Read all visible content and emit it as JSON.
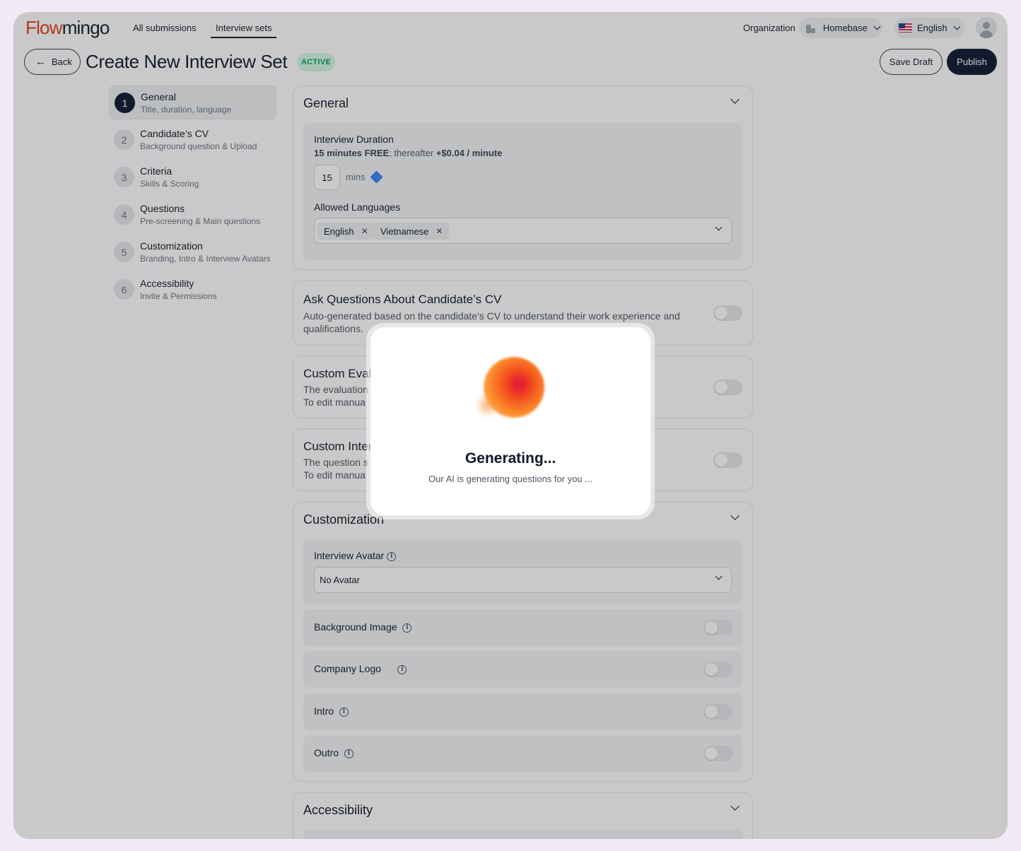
{
  "header": {
    "logo_part1": "Flow",
    "logo_part2": "mingo",
    "nav": [
      "All submissions",
      "Interview sets"
    ],
    "org_label": "Organization",
    "org_name": "Homebase",
    "language": "English"
  },
  "title_bar": {
    "back": "Back",
    "title": "Create New Interview Set",
    "status": "ACTIVE",
    "save_draft": "Save Draft",
    "publish": "Publish"
  },
  "steps": [
    {
      "num": "1",
      "title": "General",
      "sub": "Title, duration, language"
    },
    {
      "num": "2",
      "title": "Candidate’s CV",
      "sub": "Background question & Upload"
    },
    {
      "num": "3",
      "title": "Criteria",
      "sub": "Skills & Scoring"
    },
    {
      "num": "4",
      "title": "Questions",
      "sub": "Pre-screening & Main questions"
    },
    {
      "num": "5",
      "title": "Customization",
      "sub": "Branding, Intro & Interview Avatars"
    },
    {
      "num": "6",
      "title": "Accessibility",
      "sub": "Invite & Permissions"
    }
  ],
  "general": {
    "title": "General",
    "duration_label": "Interview Duration",
    "duration_free": "15 minutes FREE",
    "duration_mid": "; thereafter ",
    "duration_rate": "+$0.04 / minute",
    "duration_value": "15",
    "duration_unit": "mins",
    "languages_label": "Allowed Languages",
    "languages": [
      "English",
      "Vietnamese"
    ]
  },
  "cv_card": {
    "title": "Ask Questions About Candidate’s CV",
    "desc_line1": "Auto-generated based on the candidate's CV to understand their work experience and",
    "desc_line2": "qualifications."
  },
  "eval_card": {
    "title": "Custom Eval",
    "desc_line1": "The evaluation",
    "desc_line2": "To edit manua"
  },
  "interview_card": {
    "title": "Custom Inter",
    "desc_line1": "The question s",
    "desc_line2": "To edit manua"
  },
  "customization": {
    "title": "Customization",
    "avatar_label": "Interview Avatar",
    "avatar_value": "No Avatar",
    "rows": [
      "Background Image",
      "Company Logo",
      "Intro",
      "Outro"
    ]
  },
  "accessibility": {
    "title": "Accessibility"
  },
  "modal": {
    "title": "Generating...",
    "subtitle": "Our AI is generating questions for you ..."
  }
}
